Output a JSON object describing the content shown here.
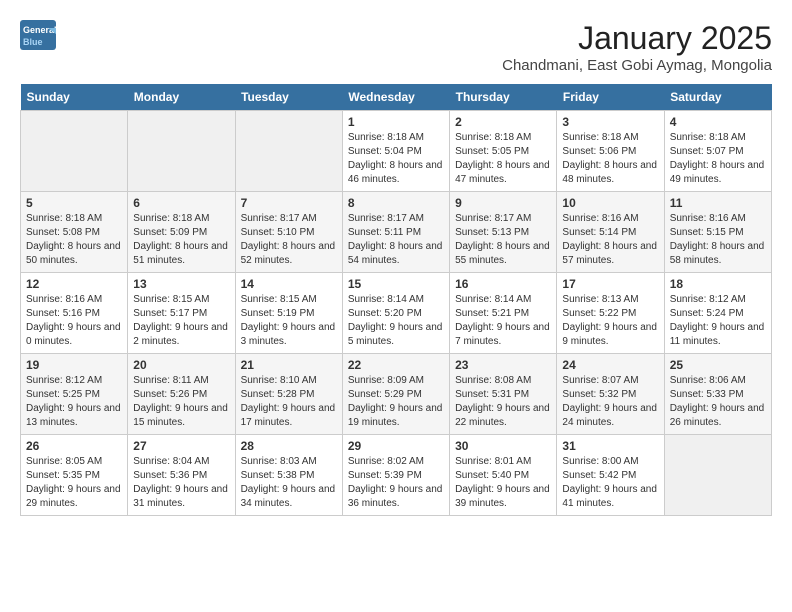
{
  "header": {
    "logo_line1": "General",
    "logo_line2": "Blue",
    "title": "January 2025",
    "subtitle": "Chandmani, East Gobi Aymag, Mongolia"
  },
  "weekdays": [
    "Sunday",
    "Monday",
    "Tuesday",
    "Wednesday",
    "Thursday",
    "Friday",
    "Saturday"
  ],
  "weeks": [
    [
      {
        "day": "",
        "info": ""
      },
      {
        "day": "",
        "info": ""
      },
      {
        "day": "",
        "info": ""
      },
      {
        "day": "1",
        "info": "Sunrise: 8:18 AM\nSunset: 5:04 PM\nDaylight: 8 hours and 46 minutes."
      },
      {
        "day": "2",
        "info": "Sunrise: 8:18 AM\nSunset: 5:05 PM\nDaylight: 8 hours and 47 minutes."
      },
      {
        "day": "3",
        "info": "Sunrise: 8:18 AM\nSunset: 5:06 PM\nDaylight: 8 hours and 48 minutes."
      },
      {
        "day": "4",
        "info": "Sunrise: 8:18 AM\nSunset: 5:07 PM\nDaylight: 8 hours and 49 minutes."
      }
    ],
    [
      {
        "day": "5",
        "info": "Sunrise: 8:18 AM\nSunset: 5:08 PM\nDaylight: 8 hours and 50 minutes."
      },
      {
        "day": "6",
        "info": "Sunrise: 8:18 AM\nSunset: 5:09 PM\nDaylight: 8 hours and 51 minutes."
      },
      {
        "day": "7",
        "info": "Sunrise: 8:17 AM\nSunset: 5:10 PM\nDaylight: 8 hours and 52 minutes."
      },
      {
        "day": "8",
        "info": "Sunrise: 8:17 AM\nSunset: 5:11 PM\nDaylight: 8 hours and 54 minutes."
      },
      {
        "day": "9",
        "info": "Sunrise: 8:17 AM\nSunset: 5:13 PM\nDaylight: 8 hours and 55 minutes."
      },
      {
        "day": "10",
        "info": "Sunrise: 8:16 AM\nSunset: 5:14 PM\nDaylight: 8 hours and 57 minutes."
      },
      {
        "day": "11",
        "info": "Sunrise: 8:16 AM\nSunset: 5:15 PM\nDaylight: 8 hours and 58 minutes."
      }
    ],
    [
      {
        "day": "12",
        "info": "Sunrise: 8:16 AM\nSunset: 5:16 PM\nDaylight: 9 hours and 0 minutes."
      },
      {
        "day": "13",
        "info": "Sunrise: 8:15 AM\nSunset: 5:17 PM\nDaylight: 9 hours and 2 minutes."
      },
      {
        "day": "14",
        "info": "Sunrise: 8:15 AM\nSunset: 5:19 PM\nDaylight: 9 hours and 3 minutes."
      },
      {
        "day": "15",
        "info": "Sunrise: 8:14 AM\nSunset: 5:20 PM\nDaylight: 9 hours and 5 minutes."
      },
      {
        "day": "16",
        "info": "Sunrise: 8:14 AM\nSunset: 5:21 PM\nDaylight: 9 hours and 7 minutes."
      },
      {
        "day": "17",
        "info": "Sunrise: 8:13 AM\nSunset: 5:22 PM\nDaylight: 9 hours and 9 minutes."
      },
      {
        "day": "18",
        "info": "Sunrise: 8:12 AM\nSunset: 5:24 PM\nDaylight: 9 hours and 11 minutes."
      }
    ],
    [
      {
        "day": "19",
        "info": "Sunrise: 8:12 AM\nSunset: 5:25 PM\nDaylight: 9 hours and 13 minutes."
      },
      {
        "day": "20",
        "info": "Sunrise: 8:11 AM\nSunset: 5:26 PM\nDaylight: 9 hours and 15 minutes."
      },
      {
        "day": "21",
        "info": "Sunrise: 8:10 AM\nSunset: 5:28 PM\nDaylight: 9 hours and 17 minutes."
      },
      {
        "day": "22",
        "info": "Sunrise: 8:09 AM\nSunset: 5:29 PM\nDaylight: 9 hours and 19 minutes."
      },
      {
        "day": "23",
        "info": "Sunrise: 8:08 AM\nSunset: 5:31 PM\nDaylight: 9 hours and 22 minutes."
      },
      {
        "day": "24",
        "info": "Sunrise: 8:07 AM\nSunset: 5:32 PM\nDaylight: 9 hours and 24 minutes."
      },
      {
        "day": "25",
        "info": "Sunrise: 8:06 AM\nSunset: 5:33 PM\nDaylight: 9 hours and 26 minutes."
      }
    ],
    [
      {
        "day": "26",
        "info": "Sunrise: 8:05 AM\nSunset: 5:35 PM\nDaylight: 9 hours and 29 minutes."
      },
      {
        "day": "27",
        "info": "Sunrise: 8:04 AM\nSunset: 5:36 PM\nDaylight: 9 hours and 31 minutes."
      },
      {
        "day": "28",
        "info": "Sunrise: 8:03 AM\nSunset: 5:38 PM\nDaylight: 9 hours and 34 minutes."
      },
      {
        "day": "29",
        "info": "Sunrise: 8:02 AM\nSunset: 5:39 PM\nDaylight: 9 hours and 36 minutes."
      },
      {
        "day": "30",
        "info": "Sunrise: 8:01 AM\nSunset: 5:40 PM\nDaylight: 9 hours and 39 minutes."
      },
      {
        "day": "31",
        "info": "Sunrise: 8:00 AM\nSunset: 5:42 PM\nDaylight: 9 hours and 41 minutes."
      },
      {
        "day": "",
        "info": ""
      }
    ]
  ]
}
